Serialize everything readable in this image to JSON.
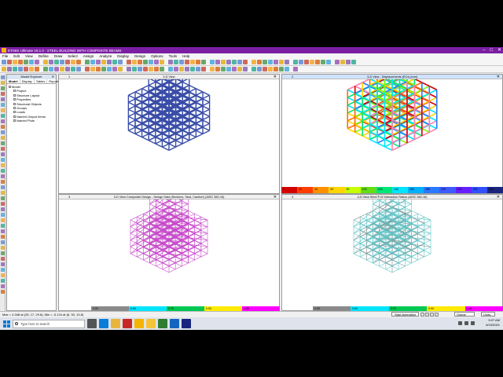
{
  "window": {
    "title": "ETABS Ultimate 19.1.0 - STEEL BUILDING WITH COMPOSITE BEAMS",
    "minimize": "–",
    "maximize": "□",
    "close": "✕"
  },
  "menu": [
    "File",
    "Edit",
    "View",
    "Define",
    "Draw",
    "Select",
    "Assign",
    "Analyze",
    "Display",
    "Design",
    "Options",
    "Tools",
    "Help"
  ],
  "explorer": {
    "title": "Model Explorer",
    "close": "✕",
    "tabs": [
      "Model",
      "Display",
      "Tables",
      "Reports"
    ],
    "root": "Model",
    "items": [
      "Project",
      "Structure Layout",
      "Properties",
      "Structural Objects",
      "Groups",
      "Loads",
      "Named Output Items",
      "Named Plots"
    ]
  },
  "panes": [
    {
      "num": "1",
      "title": "3-D View",
      "close": "✕"
    },
    {
      "num": "2",
      "title": "3-D View - Displacements (ECx) [mm]",
      "close": "✕"
    },
    {
      "num": "3",
      "title": "3-D View Composite Design - Design Data (Sections, Stud, Camber) (AISC 360-16)",
      "close": "✕"
    },
    {
      "num": "4",
      "title": "3-D View  Steel P-M Interaction Ratios  (AISC 360-16)",
      "close": "✕"
    }
  ],
  "legends": {
    "displacement": [
      "0",
      "20",
      "40",
      "60",
      "80",
      "100",
      "120",
      "140",
      "160",
      "180",
      "200",
      "220",
      "240",
      "260"
    ],
    "composite": [
      "0.00",
      "0.50",
      "0.70",
      "0.90",
      "1.00"
    ],
    "steel": [
      "0.00",
      "0.50",
      "0.70",
      "0.90",
      "1.00"
    ]
  },
  "colors": {
    "titlebar": "#7b1fa2",
    "frame_blue": "#3a4ea8",
    "frame_magenta": "#c64ac9",
    "frame_cyan": "#63c6c9"
  },
  "status": {
    "coords": "Max = 4.348 at (25, 17, 29.6);  Min = -0.124 at (6, 30, 13.8)",
    "animation": "Start Animation",
    "coord_system": "Global",
    "units": "Units..."
  },
  "taskbar": {
    "search_placeholder": "Type here to search",
    "time": "9:07 AM",
    "date": "6/15/2021"
  }
}
